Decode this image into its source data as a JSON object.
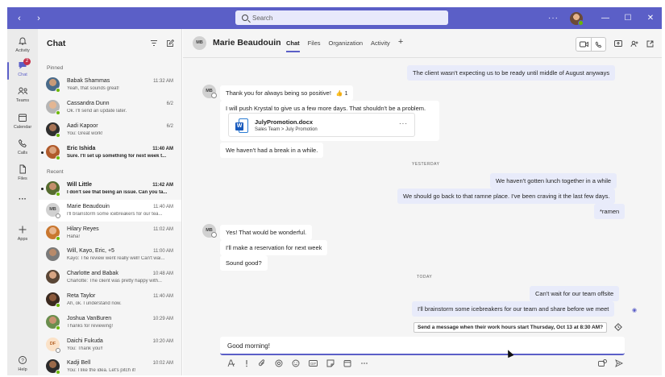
{
  "window": {
    "search_placeholder": "Search",
    "more": "···",
    "nav_back": "‹",
    "nav_forward": "›",
    "minimize": "—",
    "maximize": "☐",
    "close": "✕"
  },
  "rail": {
    "items": [
      {
        "label": "Activity",
        "icon": "bell-icon"
      },
      {
        "label": "Chat",
        "icon": "chat-icon",
        "badge": "2"
      },
      {
        "label": "Teams",
        "icon": "teams-icon"
      },
      {
        "label": "Calendar",
        "icon": "calendar-icon"
      },
      {
        "label": "Calls",
        "icon": "phone-icon"
      },
      {
        "label": "Files",
        "icon": "file-icon"
      },
      {
        "label": "···",
        "icon": "more-icon"
      },
      {
        "label": "Apps",
        "icon": "plus-icon"
      },
      {
        "label": "Help",
        "icon": "help-icon"
      }
    ]
  },
  "chatlist": {
    "title": "Chat",
    "pinned_label": "Pinned",
    "recent_label": "Recent",
    "pinned": [
      {
        "name": "Babak Shammas",
        "preview": "Yeah, that sounds great!",
        "time": "11:32 AM"
      },
      {
        "name": "Cassandra Dunn",
        "preview": "Ok. I'll send an update later.",
        "time": "6/2"
      },
      {
        "name": "Aadi Kapoor",
        "preview": "You: Great work!",
        "time": "6/2"
      },
      {
        "name": "Eric Ishida",
        "preview": "Sure. I'll set up something for next week t...",
        "time": "11:40 AM"
      }
    ],
    "recent": [
      {
        "name": "Will Little",
        "preview": "I don't see that being an issue. Can you ta...",
        "time": "11:42 AM"
      },
      {
        "name": "Marie Beaudouin",
        "preview": "I'll brainstorm some icebreakers for our tea...",
        "time": "11:40 AM",
        "initials": "MB"
      },
      {
        "name": "Hilary Reyes",
        "preview": "Haha!",
        "time": "11:02 AM"
      },
      {
        "name": "Will, Kayo, Eric, +5",
        "preview": "Kayo: The review went really well! Can't wai...",
        "time": "11:00 AM"
      },
      {
        "name": "Charlotte and Babak",
        "preview": "Charlotte: The client was pretty happy with...",
        "time": "10:48 AM"
      },
      {
        "name": "Reta Taylor",
        "preview": "Ah, ok. I understand now.",
        "time": "11:40 AM"
      },
      {
        "name": "Joshua VanBuren",
        "preview": "Thanks for reviewing!",
        "time": "10:29 AM"
      },
      {
        "name": "Daichi Fukuda",
        "preview": "You: Thank you!!",
        "time": "10:20 AM",
        "initials": "DF"
      },
      {
        "name": "Kadji Bell",
        "preview": "You: I like the idea. Let's pitch it!",
        "time": "10:02 AM"
      }
    ]
  },
  "conversation": {
    "initials": "MB",
    "name": "Marie Beaudouin",
    "tabs": [
      "Chat",
      "Files",
      "Organization",
      "Activity"
    ],
    "add_tab": "+",
    "messages": {
      "m1": "The client wasn't expecting us to be ready until middle of August anyways",
      "m2": "Thank you for always being so positive!",
      "m2_reaction": "👍 1",
      "m3": "I will push Krystal to give us a few more days. That shouldn't be a problem.",
      "m4": "We haven't had a break in a while.",
      "m5": "We haven't gotten lunch together in a while",
      "m6": "We should go back to that ramne place. I've been craving it the last few days.",
      "m7": "*ramen",
      "m8": "Yes! That would be wonderful.",
      "m9": "I'll make a reservation for next week",
      "m10": "Sound good?",
      "m11": "Can't wait for our team offsite",
      "m12": "I'll brainstorm some icebreakers for our team and share before we meet"
    },
    "dividers": {
      "yesterday": "YESTERDAY",
      "today": "TODAY"
    },
    "file": {
      "name": "JulyPromotion.docx",
      "path": "Sales Team > July Promotion",
      "more": "···"
    },
    "schedule_hint": "Send a message when their work hours start Thursday, Oct 13 at 8:30 AM?",
    "compose_value": "Good morning!"
  }
}
